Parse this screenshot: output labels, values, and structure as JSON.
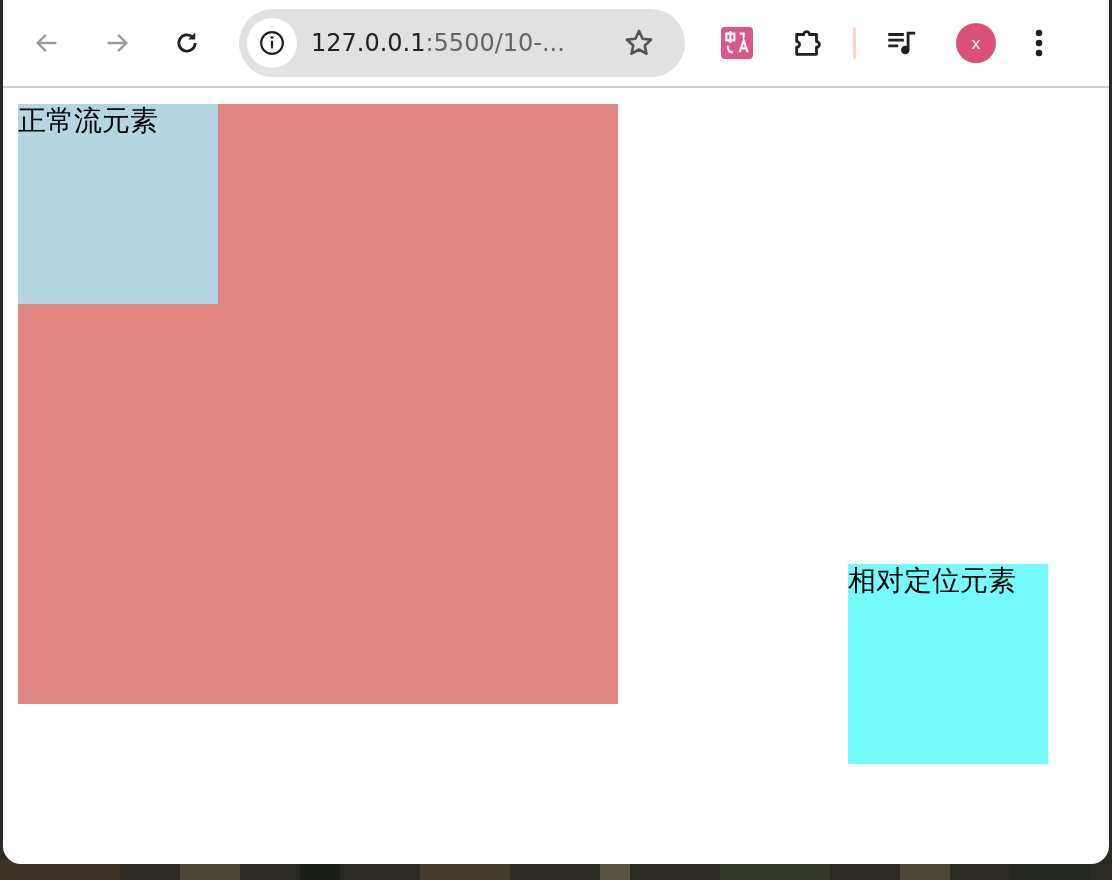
{
  "toolbar": {
    "back": {
      "disabled": true
    },
    "forward": {
      "disabled": true
    },
    "address": {
      "host": "127.0.0.1",
      "rest": ":5500/10-..."
    },
    "profile": {
      "initial": "x",
      "color": "#db5079"
    }
  },
  "page": {
    "boxes": [
      {
        "kind": "container",
        "color": "#e08683",
        "children": [
          {
            "kind": "normal",
            "label": "正常流元素",
            "color": "#b4d6e3"
          }
        ]
      },
      {
        "kind": "relative",
        "label": "相对定位元素",
        "color": "#76fbfb"
      }
    ]
  }
}
